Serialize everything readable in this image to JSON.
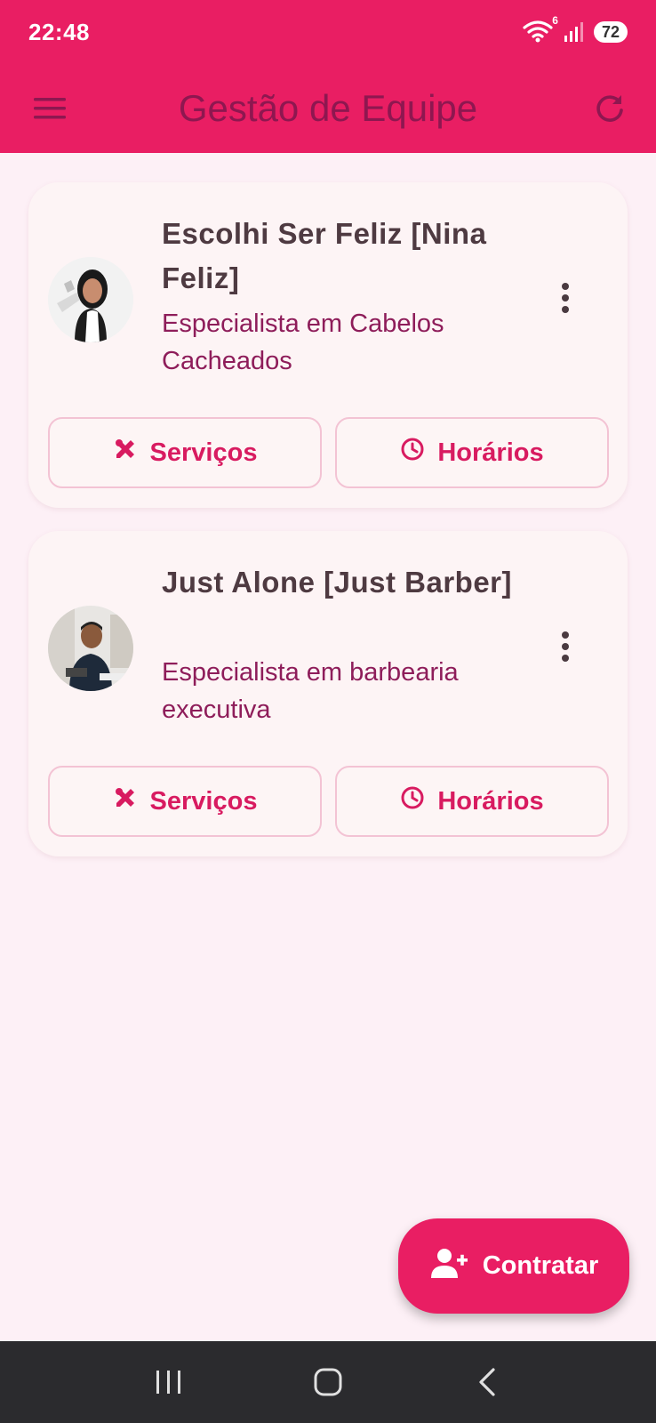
{
  "status_bar": {
    "time": "22:48",
    "wifi_badge": "6",
    "battery": "72"
  },
  "app_bar": {
    "title": "Gestão de Equipe",
    "menu_icon": "hamburger-menu-icon",
    "refresh_icon": "refresh-icon",
    "background_color": "#e91e63",
    "title_color": "#8e1750"
  },
  "team": [
    {
      "name": "Escolhi Ser Feliz [Nina Feliz]",
      "specialty": "Especialista em Cabelos Cacheados",
      "services_label": "Serviços",
      "schedule_label": "Horários"
    },
    {
      "name": "Just Alone [Just Barber]",
      "specialty": "Especialista em barbearia executiva",
      "services_label": "Serviços",
      "schedule_label": "Horários"
    }
  ],
  "fab": {
    "label": "Contratar",
    "icon": "person-add-icon"
  },
  "nav": {
    "recent_icon": "recent-apps-icon",
    "home_icon": "home-icon",
    "back_icon": "back-icon"
  },
  "colors": {
    "accent": "#e91e63",
    "button_text": "#d81b60",
    "specialty_text": "#8e1d5a",
    "name_text": "#4e3a41",
    "page_background": "#fdf0f6"
  }
}
